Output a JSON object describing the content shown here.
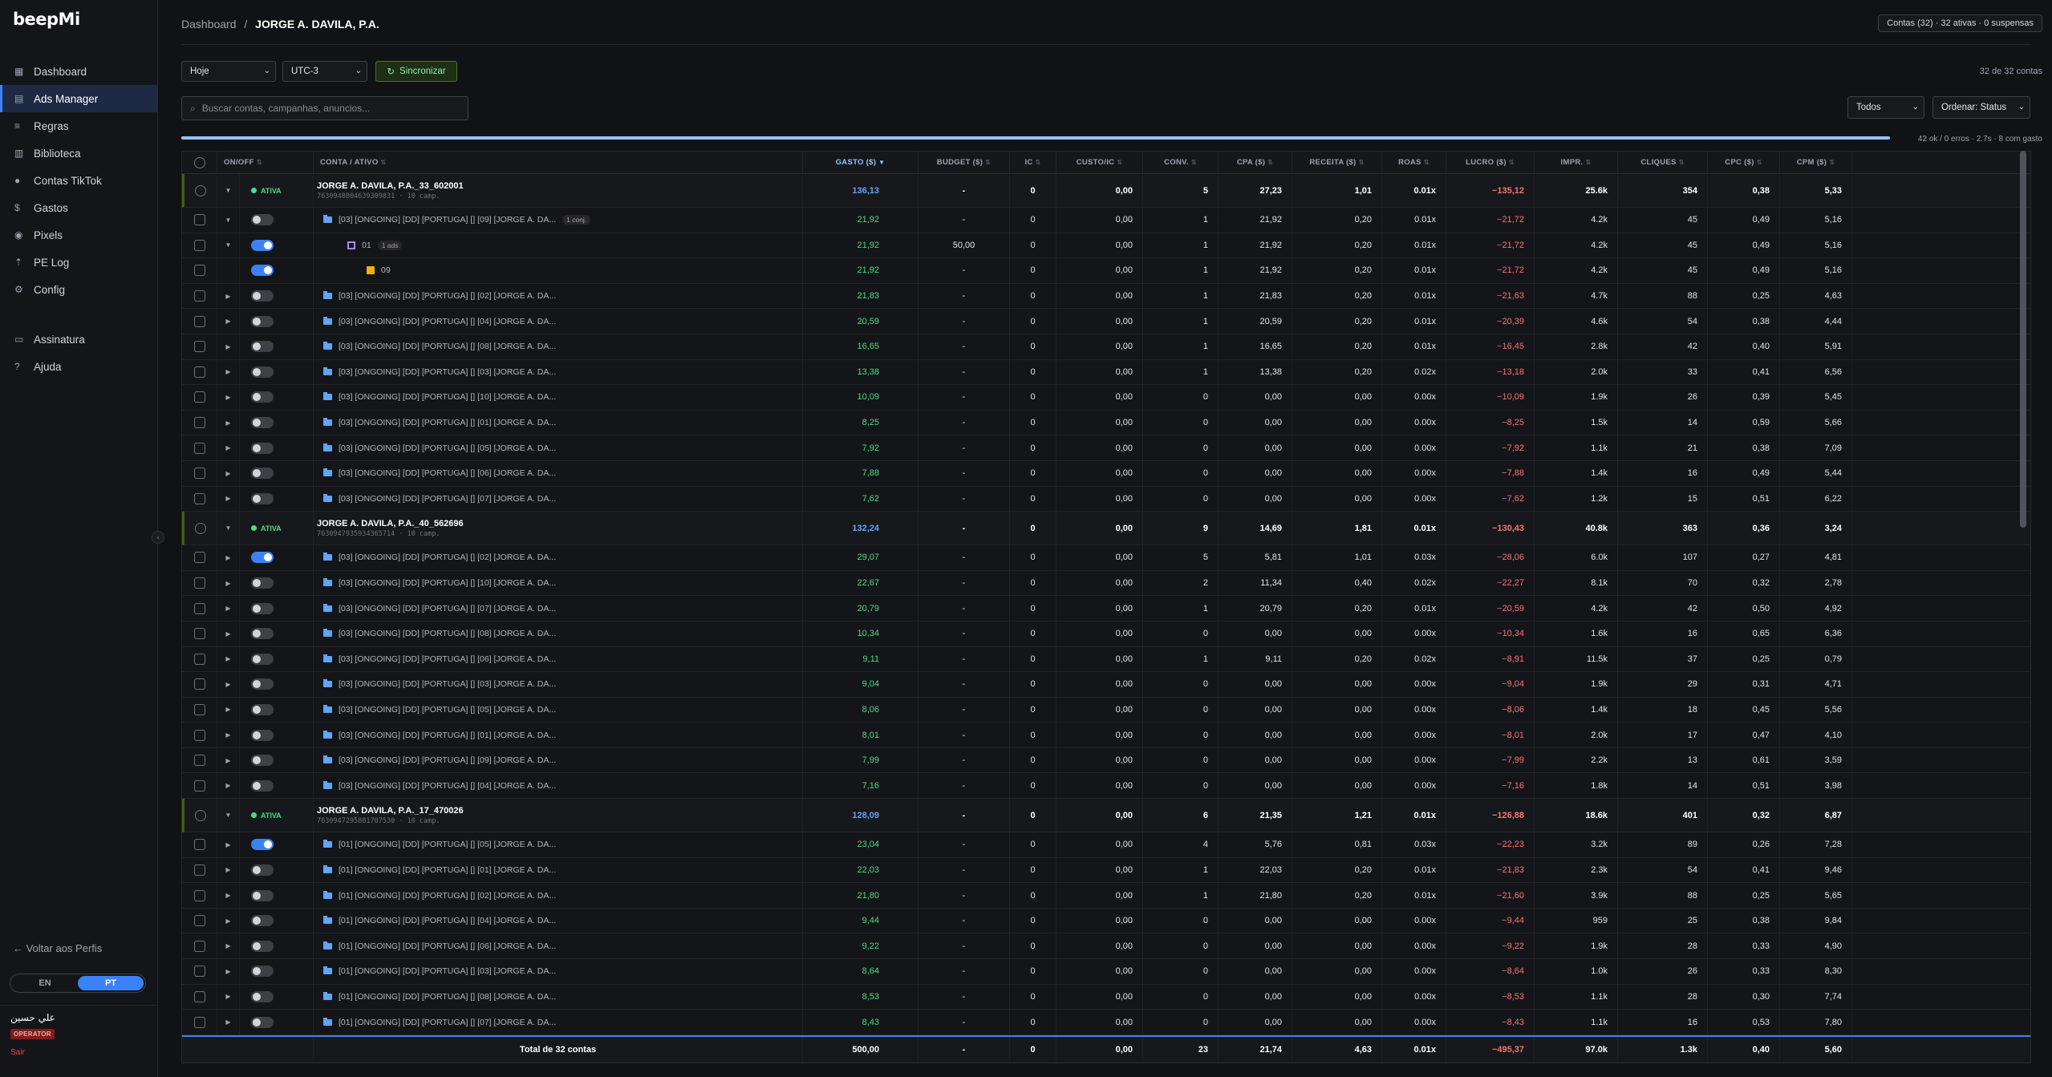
{
  "app": {
    "logo": "beepMi"
  },
  "sidebar": {
    "items": [
      {
        "label": "Dashboard",
        "icon": "dashboard-icon",
        "glyph": "▦"
      },
      {
        "label": "Ads Manager",
        "icon": "ads-manager-icon",
        "glyph": "▤",
        "active": true
      },
      {
        "label": "Regras",
        "icon": "rules-icon",
        "glyph": "≡"
      },
      {
        "label": "Biblioteca",
        "icon": "library-icon",
        "glyph": "▥"
      },
      {
        "label": "Contas TikTok",
        "icon": "tiktok-accounts-icon",
        "glyph": "●"
      },
      {
        "label": "Gastos",
        "icon": "dollar-icon",
        "glyph": "$"
      },
      {
        "label": "Pixels",
        "icon": "pixel-icon",
        "glyph": "◉"
      },
      {
        "label": "PE Log",
        "icon": "upload-icon",
        "glyph": "⇡"
      },
      {
        "label": "Config",
        "icon": "gear-icon",
        "glyph": "⚙"
      }
    ],
    "items2": [
      {
        "label": "Assinatura",
        "icon": "card-icon",
        "glyph": "▭"
      },
      {
        "label": "Ajuda",
        "icon": "help-icon",
        "glyph": "?"
      }
    ],
    "back": "← Voltar aos Perfis",
    "lang": [
      "EN",
      "PT"
    ],
    "user": "علي حسين",
    "role": "OPERATOR",
    "logout": "Sair"
  },
  "header": {
    "crumb_root": "Dashboard",
    "crumb_sep": "/",
    "crumb_current": "JORGE A. DAVILA, P.A.",
    "accounts_badge": "Contas (32) · 32 ativas · 0 suspensas"
  },
  "toolbar": {
    "period": "Hoje",
    "timezone": "UTC-3",
    "sync": "Sincronizar",
    "count": "32 de 32 contas",
    "search_placeholder": "Buscar contas, campanhas, anuncios...",
    "filter": "Todos",
    "sort": "Ordenar: Status",
    "progress": 1.0,
    "progress_text": "42 ok / 0 erros · 2.7s · 8 com gasto"
  },
  "columns": [
    "ON/OFF",
    "CONTA / ATIVO",
    "GASTO ($)",
    "BUDGET ($)",
    "IC",
    "CUSTO/IC",
    "CONV.",
    "CPA ($)",
    "RECEITA ($)",
    "ROAS",
    "LUCRO ($)",
    "IMPR.",
    "CLIQUES",
    "CPC ($)",
    "CPM ($)"
  ],
  "status_label": "ATIVA",
  "rows": [
    {
      "t": "acct",
      "name": "JORGE A. DAVILA, P.A._33_602001",
      "id": "7630948804639309831 · 10 camp.",
      "v": [
        "136,13",
        "-",
        "0",
        "0,00",
        "5",
        "27,23",
        "1,01",
        "0.01x",
        "−135,12",
        "25.6k",
        "354",
        "0,38",
        "5,33"
      ]
    },
    {
      "t": "camp",
      "exp": "▼",
      "name": "[03] [ONGOING] [DD] [PORTUGA] [] [09] [JORGE A. DA...",
      "badge": "1 conj.",
      "v": [
        "21,92",
        "-",
        "0",
        "0,00",
        "1",
        "21,92",
        "0,20",
        "0.01x",
        "−21,72",
        "4.2k",
        "45",
        "0,49",
        "5,16"
      ]
    },
    {
      "t": "set",
      "exp": "▼",
      "on": true,
      "name": "01",
      "badge": "1 ads",
      "v": [
        "21,92",
        "50,00",
        "0",
        "0,00",
        "1",
        "21,92",
        "0,20",
        "0.01x",
        "−21,72",
        "4.2k",
        "45",
        "0,49",
        "5,16"
      ]
    },
    {
      "t": "ad",
      "on": true,
      "name": "09",
      "v": [
        "21,92",
        "-",
        "0",
        "0,00",
        "1",
        "21,92",
        "0,20",
        "0.01x",
        "−21,72",
        "4.2k",
        "45",
        "0,49",
        "5,16"
      ]
    },
    {
      "t": "camp",
      "exp": "▶",
      "name": "[03] [ONGOING] [DD] [PORTUGA] [] [02] [JORGE A. DA...",
      "v": [
        "21,83",
        "-",
        "0",
        "0,00",
        "1",
        "21,83",
        "0,20",
        "0.01x",
        "−21,63",
        "4.7k",
        "88",
        "0,25",
        "4,63"
      ]
    },
    {
      "t": "camp",
      "exp": "▶",
      "name": "[03] [ONGOING] [DD] [PORTUGA] [] [04] [JORGE A. DA...",
      "v": [
        "20,59",
        "-",
        "0",
        "0,00",
        "1",
        "20,59",
        "0,20",
        "0.01x",
        "−20,39",
        "4.6k",
        "54",
        "0,38",
        "4,44"
      ]
    },
    {
      "t": "camp",
      "exp": "▶",
      "name": "[03] [ONGOING] [DD] [PORTUGA] [] [08] [JORGE A. DA...",
      "v": [
        "16,65",
        "-",
        "0",
        "0,00",
        "1",
        "16,65",
        "0,20",
        "0.01x",
        "−16,45",
        "2.8k",
        "42",
        "0,40",
        "5,91"
      ]
    },
    {
      "t": "camp",
      "exp": "▶",
      "name": "[03] [ONGOING] [DD] [PORTUGA] [] [03] [JORGE A. DA...",
      "v": [
        "13,38",
        "-",
        "0",
        "0,00",
        "1",
        "13,38",
        "0,20",
        "0.02x",
        "−13,18",
        "2.0k",
        "33",
        "0,41",
        "6,56"
      ]
    },
    {
      "t": "camp",
      "exp": "▶",
      "name": "[03] [ONGOING] [DD] [PORTUGA] [] [10] [JORGE A. DA...",
      "v": [
        "10,09",
        "-",
        "0",
        "0,00",
        "0",
        "0,00",
        "0,00",
        "0.00x",
        "−10,09",
        "1.9k",
        "26",
        "0,39",
        "5,45"
      ]
    },
    {
      "t": "camp",
      "exp": "▶",
      "name": "[03] [ONGOING] [DD] [PORTUGA] [] [01] [JORGE A. DA...",
      "v": [
        "8,25",
        "-",
        "0",
        "0,00",
        "0",
        "0,00",
        "0,00",
        "0.00x",
        "−8,25",
        "1.5k",
        "14",
        "0,59",
        "5,66"
      ]
    },
    {
      "t": "camp",
      "exp": "▶",
      "name": "[03] [ONGOING] [DD] [PORTUGA] [] [05] [JORGE A. DA...",
      "v": [
        "7,92",
        "-",
        "0",
        "0,00",
        "0",
        "0,00",
        "0,00",
        "0.00x",
        "−7,92",
        "1.1k",
        "21",
        "0,38",
        "7,09"
      ]
    },
    {
      "t": "camp",
      "exp": "▶",
      "name": "[03] [ONGOING] [DD] [PORTUGA] [] [06] [JORGE A. DA...",
      "v": [
        "7,88",
        "-",
        "0",
        "0,00",
        "0",
        "0,00",
        "0,00",
        "0.00x",
        "−7,88",
        "1.4k",
        "16",
        "0,49",
        "5,44"
      ]
    },
    {
      "t": "camp",
      "exp": "▶",
      "name": "[03] [ONGOING] [DD] [PORTUGA] [] [07] [JORGE A. DA...",
      "v": [
        "7,62",
        "-",
        "0",
        "0,00",
        "0",
        "0,00",
        "0,00",
        "0.00x",
        "−7,62",
        "1.2k",
        "15",
        "0,51",
        "6,22"
      ]
    },
    {
      "t": "acct",
      "name": "JORGE A. DAVILA, P.A._40_562696",
      "id": "7630947935934365714 · 10 camp.",
      "v": [
        "132,24",
        "-",
        "0",
        "0,00",
        "9",
        "14,69",
        "1,81",
        "0.01x",
        "−130,43",
        "40.8k",
        "363",
        "0,36",
        "3,24"
      ]
    },
    {
      "t": "camp",
      "exp": "▶",
      "on": true,
      "name": "[03] [ONGOING] [DD] [PORTUGA] [] [02] [JORGE A. DA...",
      "v": [
        "29,07",
        "-",
        "0",
        "0,00",
        "5",
        "5,81",
        "1,01",
        "0.03x",
        "−28,06",
        "6.0k",
        "107",
        "0,27",
        "4,81"
      ]
    },
    {
      "t": "camp",
      "exp": "▶",
      "name": "[03] [ONGOING] [DD] [PORTUGA] [] [10] [JORGE A. DA...",
      "v": [
        "22,67",
        "-",
        "0",
        "0,00",
        "2",
        "11,34",
        "0,40",
        "0.02x",
        "−22,27",
        "8.1k",
        "70",
        "0,32",
        "2,78"
      ]
    },
    {
      "t": "camp",
      "exp": "▶",
      "name": "[03] [ONGOING] [DD] [PORTUGA] [] [07] [JORGE A. DA...",
      "v": [
        "20,79",
        "-",
        "0",
        "0,00",
        "1",
        "20,79",
        "0,20",
        "0.01x",
        "−20,59",
        "4.2k",
        "42",
        "0,50",
        "4,92"
      ]
    },
    {
      "t": "camp",
      "exp": "▶",
      "name": "[03] [ONGOING] [DD] [PORTUGA] [] [08] [JORGE A. DA...",
      "v": [
        "10,34",
        "-",
        "0",
        "0,00",
        "0",
        "0,00",
        "0,00",
        "0.00x",
        "−10,34",
        "1.6k",
        "16",
        "0,65",
        "6,36"
      ]
    },
    {
      "t": "camp",
      "exp": "▶",
      "name": "[03] [ONGOING] [DD] [PORTUGA] [] [06] [JORGE A. DA...",
      "v": [
        "9,11",
        "-",
        "0",
        "0,00",
        "1",
        "9,11",
        "0,20",
        "0.02x",
        "−8,91",
        "11.5k",
        "37",
        "0,25",
        "0,79"
      ]
    },
    {
      "t": "camp",
      "exp": "▶",
      "name": "[03] [ONGOING] [DD] [PORTUGA] [] [03] [JORGE A. DA...",
      "v": [
        "9,04",
        "-",
        "0",
        "0,00",
        "0",
        "0,00",
        "0,00",
        "0.00x",
        "−9,04",
        "1.9k",
        "29",
        "0,31",
        "4,71"
      ]
    },
    {
      "t": "camp",
      "exp": "▶",
      "name": "[03] [ONGOING] [DD] [PORTUGA] [] [05] [JORGE A. DA...",
      "v": [
        "8,06",
        "-",
        "0",
        "0,00",
        "0",
        "0,00",
        "0,00",
        "0.00x",
        "−8,06",
        "1.4k",
        "18",
        "0,45",
        "5,56"
      ]
    },
    {
      "t": "camp",
      "exp": "▶",
      "name": "[03] [ONGOING] [DD] [PORTUGA] [] [01] [JORGE A. DA...",
      "v": [
        "8,01",
        "-",
        "0",
        "0,00",
        "0",
        "0,00",
        "0,00",
        "0.00x",
        "−8,01",
        "2.0k",
        "17",
        "0,47",
        "4,10"
      ]
    },
    {
      "t": "camp",
      "exp": "▶",
      "name": "[03] [ONGOING] [DD] [PORTUGA] [] [09] [JORGE A. DA...",
      "v": [
        "7,99",
        "-",
        "0",
        "0,00",
        "0",
        "0,00",
        "0,00",
        "0.00x",
        "−7,99",
        "2.2k",
        "13",
        "0,61",
        "3,59"
      ]
    },
    {
      "t": "camp",
      "exp": "▶",
      "name": "[03] [ONGOING] [DD] [PORTUGA] [] [04] [JORGE A. DA...",
      "v": [
        "7,16",
        "-",
        "0",
        "0,00",
        "0",
        "0,00",
        "0,00",
        "0.00x",
        "−7,16",
        "1.8k",
        "14",
        "0,51",
        "3,98"
      ]
    },
    {
      "t": "acct",
      "name": "JORGE A. DAVILA, P.A._17_470026",
      "id": "7630947295881707530 · 10 camp.",
      "v": [
        "128,09",
        "-",
        "0",
        "0,00",
        "6",
        "21,35",
        "1,21",
        "0.01x",
        "−126,88",
        "18.6k",
        "401",
        "0,32",
        "6,87"
      ]
    },
    {
      "t": "camp",
      "exp": "▶",
      "on": true,
      "name": "[01] [ONGOING] [DD] [PORTUGA] [] [05] [JORGE A. DA...",
      "v": [
        "23,04",
        "-",
        "0",
        "0,00",
        "4",
        "5,76",
        "0,81",
        "0.03x",
        "−22,23",
        "3.2k",
        "89",
        "0,26",
        "7,28"
      ]
    },
    {
      "t": "camp",
      "exp": "▶",
      "name": "[01] [ONGOING] [DD] [PORTUGA] [] [01] [JORGE A. DA...",
      "v": [
        "22,03",
        "-",
        "0",
        "0,00",
        "1",
        "22,03",
        "0,20",
        "0.01x",
        "−21,83",
        "2.3k",
        "54",
        "0,41",
        "9,46"
      ]
    },
    {
      "t": "camp",
      "exp": "▶",
      "name": "[01] [ONGOING] [DD] [PORTUGA] [] [02] [JORGE A. DA...",
      "v": [
        "21,80",
        "-",
        "0",
        "0,00",
        "1",
        "21,80",
        "0,20",
        "0.01x",
        "−21,60",
        "3.9k",
        "88",
        "0,25",
        "5,65"
      ]
    },
    {
      "t": "camp",
      "exp": "▶",
      "name": "[01] [ONGOING] [DD] [PORTUGA] [] [04] [JORGE A. DA...",
      "v": [
        "9,44",
        "-",
        "0",
        "0,00",
        "0",
        "0,00",
        "0,00",
        "0.00x",
        "−9,44",
        "959",
        "25",
        "0,38",
        "9,84"
      ]
    },
    {
      "t": "camp",
      "exp": "▶",
      "name": "[01] [ONGOING] [DD] [PORTUGA] [] [06] [JORGE A. DA...",
      "v": [
        "9,22",
        "-",
        "0",
        "0,00",
        "0",
        "0,00",
        "0,00",
        "0.00x",
        "−9,22",
        "1.9k",
        "28",
        "0,33",
        "4,90"
      ]
    },
    {
      "t": "camp",
      "exp": "▶",
      "name": "[01] [ONGOING] [DD] [PORTUGA] [] [03] [JORGE A. DA...",
      "v": [
        "8,64",
        "-",
        "0",
        "0,00",
        "0",
        "0,00",
        "0,00",
        "0.00x",
        "−8,64",
        "1.0k",
        "26",
        "0,33",
        "8,30"
      ]
    },
    {
      "t": "camp",
      "exp": "▶",
      "name": "[01] [ONGOING] [DD] [PORTUGA] [] [08] [JORGE A. DA...",
      "v": [
        "8,53",
        "-",
        "0",
        "0,00",
        "0",
        "0,00",
        "0,00",
        "0.00x",
        "−8,53",
        "1.1k",
        "28",
        "0,30",
        "7,74"
      ]
    },
    {
      "t": "camp",
      "exp": "▶",
      "name": "[01] [ONGOING] [DD] [PORTUGA] [] [07] [JORGE A. DA...",
      "v": [
        "8,43",
        "-",
        "0",
        "0,00",
        "0",
        "0,00",
        "0,00",
        "0.00x",
        "−8,43",
        "1.1k",
        "16",
        "0,53",
        "7,80"
      ]
    }
  ],
  "footer": {
    "label": "Total de 32 contas",
    "v": [
      "500,00",
      "-",
      "0",
      "0,00",
      "23",
      "21,74",
      "4,63",
      "0.01x",
      "−495,37",
      "97.0k",
      "1.3k",
      "0,40",
      "5,60"
    ]
  }
}
